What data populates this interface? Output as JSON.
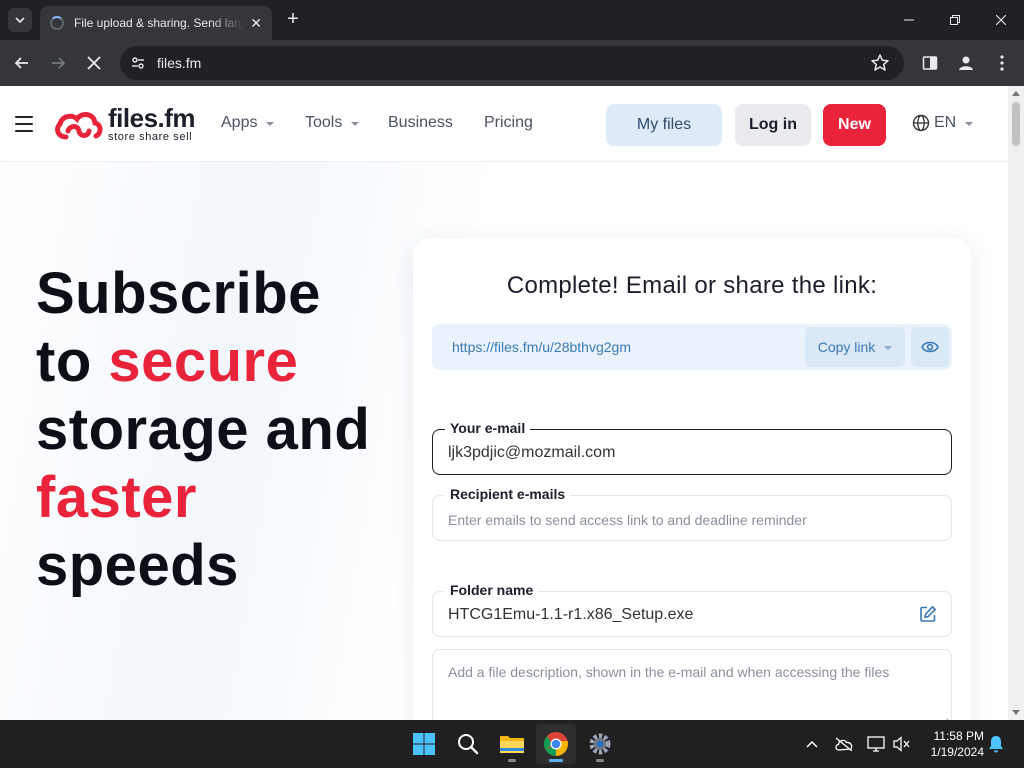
{
  "browser": {
    "tab_title": "File upload & sharing. Send large files",
    "tab_close": "✕",
    "new_tab": "+",
    "url": "files.fm"
  },
  "site": {
    "logo_name": "files.fm",
    "logo_tagline": "store share sell",
    "nav": [
      {
        "label": "Apps"
      },
      {
        "label": "Tools"
      },
      {
        "label": "Business"
      },
      {
        "label": "Pricing"
      }
    ],
    "my_files_label": "My files",
    "login_label": "Log in",
    "new_label": "New",
    "language": "EN",
    "accent_color": "#e8233a"
  },
  "hero": {
    "line1": "Subscribe",
    "line2_prefix": "to ",
    "line2_accent": "secure",
    "line3": "storage and",
    "line4_accent": "faster",
    "line5": "speeds"
  },
  "share_card": {
    "title": "Complete! Email or share the link:",
    "link_url": "https://files.fm/u/28bthvg2gm",
    "copy_link_label": "Copy link",
    "email_label": "Your e-mail",
    "email_value": "ljk3pdjic@mozmail.com",
    "recipients_label": "Recipient e-mails",
    "recipients_placeholder": "Enter emails to send access link to and deadline reminder",
    "folder_label": "Folder name",
    "folder_value": "HTCG1Emu-1.1-r1.x86_Setup.exe",
    "description_placeholder": "Add a file description, shown in the e-mail and when accessing the files"
  },
  "taskbar": {
    "time": "11:58 PM",
    "date": "1/19/2024",
    "apps": [
      "windows-start",
      "search",
      "file-explorer",
      "chrome",
      "settings"
    ]
  }
}
